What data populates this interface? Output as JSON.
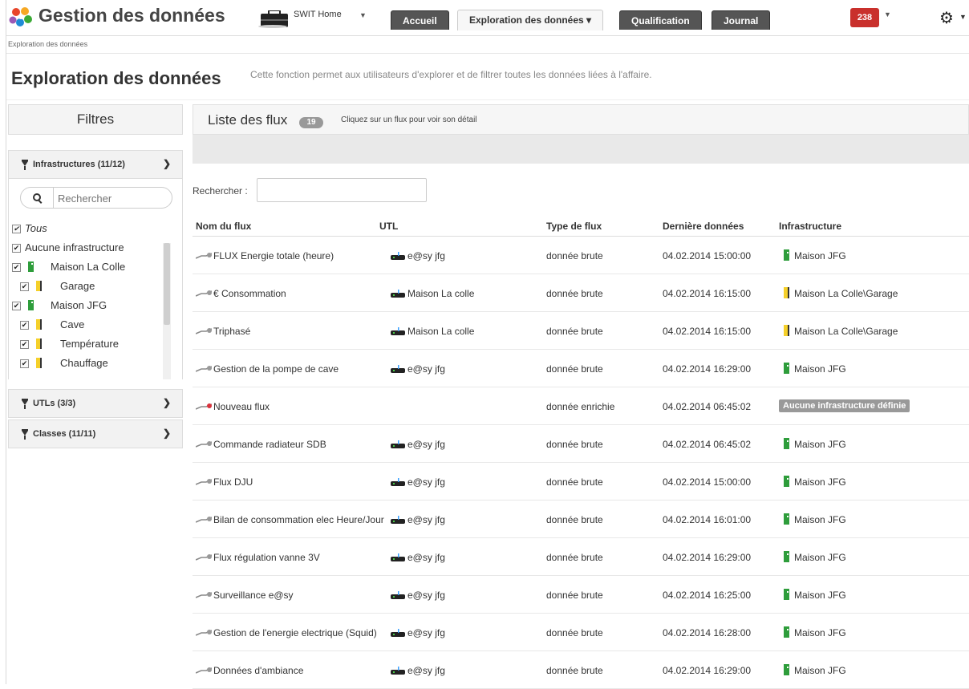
{
  "header": {
    "app_title": "Gestion des données",
    "workspace": "SWIT Home",
    "tabs": [
      {
        "label": "Accueil"
      },
      {
        "label": "Exploration des données ▾"
      },
      {
        "label": "Qualification"
      },
      {
        "label": "Journal"
      }
    ],
    "notifications": "238",
    "logo_colors": [
      "#e8452a",
      "#f6a823",
      "#3aaa35",
      "#1f8bd6",
      "#9b59b6"
    ]
  },
  "breadcrumb": "Exploration des données",
  "page": {
    "title": "Exploration des données",
    "description": "Cette fonction permet aux utilisateurs d'explorer et de filtrer toutes les données liées à l'affaire."
  },
  "sidebar": {
    "title": "Filtres",
    "sections": [
      {
        "label": "Infrastructures (11/12)"
      },
      {
        "label": "UTLs (3/3)"
      },
      {
        "label": "Classes (11/11)"
      }
    ],
    "search_placeholder": "Rechercher",
    "tree": [
      {
        "label": "Tous",
        "icon": "none"
      },
      {
        "label": "Aucune infrastructure",
        "icon": "none"
      },
      {
        "label": "Maison La Colle",
        "icon": "green-building-icon"
      },
      {
        "label": "Garage",
        "icon": "yellow-room-icon"
      },
      {
        "label": "Maison JFG",
        "icon": "green-building-icon"
      },
      {
        "label": "Cave",
        "icon": "yellow-room-icon"
      },
      {
        "label": "Température",
        "icon": "yellow-room-icon"
      },
      {
        "label": "Chauffage",
        "icon": "yellow-room-icon"
      }
    ]
  },
  "main": {
    "title": "Liste des flux",
    "count": "19",
    "hint": "Cliquez sur un flux pour voir son détail",
    "search_label": "Rechercher :",
    "columns": [
      "Nom du flux",
      "UTL",
      "Type de flux",
      "Dernière données",
      "Infrastructure"
    ],
    "rows": [
      {
        "name": "FLUX Energie totale (heure)",
        "utl": "e@sy jfg",
        "type": "donnée brute",
        "date": "04.02.2014 15:00:00",
        "infra": "Maison JFG",
        "infra_icon": "green"
      },
      {
        "name": "€ Consommation",
        "utl": "Maison La colle",
        "type": "donnée brute",
        "date": "04.02.2014 16:15:00",
        "infra": "Maison La Colle\\Garage",
        "infra_icon": "yellow"
      },
      {
        "name": "Triphasé",
        "utl": "Maison La colle",
        "type": "donnée brute",
        "date": "04.02.2014 16:15:00",
        "infra": "Maison La Colle\\Garage",
        "infra_icon": "yellow"
      },
      {
        "name": "Gestion de la pompe de cave",
        "utl": "e@sy jfg",
        "type": "donnée brute",
        "date": "04.02.2014 16:29:00",
        "infra": "Maison JFG",
        "infra_icon": "green"
      },
      {
        "name": "Nouveau flux",
        "utl": "",
        "type": "donnée enrichie",
        "date": "04.02.2014 06:45:02",
        "infra": "Aucune infrastructure définie",
        "infra_icon": "badge"
      },
      {
        "name": "Commande radiateur SDB",
        "utl": "e@sy jfg",
        "type": "donnée brute",
        "date": "04.02.2014 06:45:02",
        "infra": "Maison JFG",
        "infra_icon": "green"
      },
      {
        "name": "Flux DJU",
        "utl": "e@sy jfg",
        "type": "donnée brute",
        "date": "04.02.2014 15:00:00",
        "infra": "Maison JFG",
        "infra_icon": "green"
      },
      {
        "name": "Bilan de consommation elec Heure/Jour",
        "utl": "e@sy jfg",
        "type": "donnée brute",
        "date": "04.02.2014 16:01:00",
        "infra": "Maison JFG",
        "infra_icon": "green"
      },
      {
        "name": "Flux régulation vanne 3V",
        "utl": "e@sy jfg",
        "type": "donnée brute",
        "date": "04.02.2014 16:29:00",
        "infra": "Maison JFG",
        "infra_icon": "green"
      },
      {
        "name": "Surveillance e@sy",
        "utl": "e@sy jfg",
        "type": "donnée brute",
        "date": "04.02.2014 16:25:00",
        "infra": "Maison JFG",
        "infra_icon": "green"
      },
      {
        "name": "Gestion de l'energie electrique (Squid)",
        "utl": "e@sy jfg",
        "type": "donnée brute",
        "date": "04.02.2014 16:28:00",
        "infra": "Maison JFG",
        "infra_icon": "green"
      },
      {
        "name": "Données d'ambiance",
        "utl": "e@sy jfg",
        "type": "donnée brute",
        "date": "04.02.2014 16:29:00",
        "infra": "Maison JFG",
        "infra_icon": "green"
      }
    ]
  }
}
